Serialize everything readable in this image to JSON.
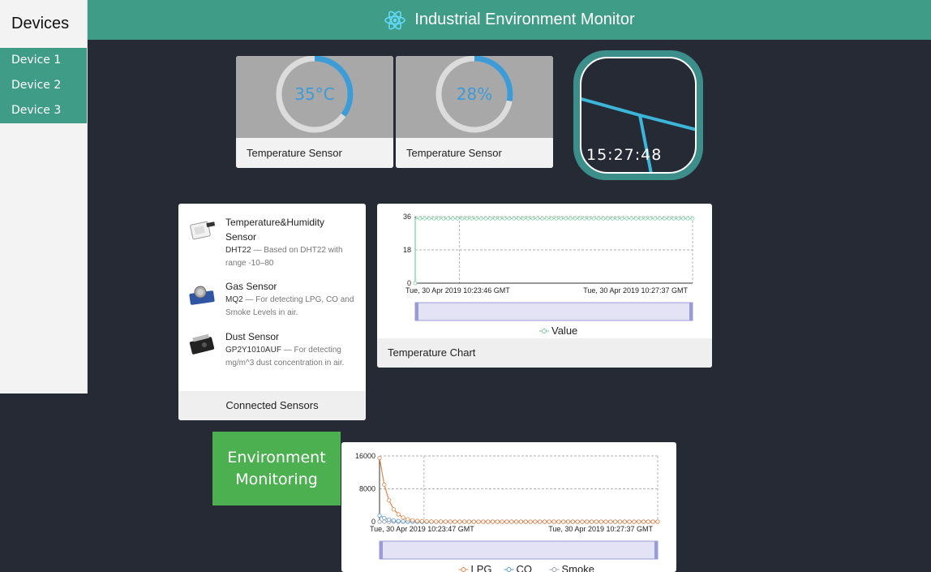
{
  "sidebar": {
    "title": "Devices",
    "items": [
      {
        "label": "Device 1"
      },
      {
        "label": "Device 2"
      },
      {
        "label": "Device 3"
      }
    ]
  },
  "header": {
    "title": "Industrial Environment Monitor",
    "icon": "react-atom-icon"
  },
  "gauges": [
    {
      "value_text": "35°C",
      "fill": 0.35,
      "label": "Temperature Sensor"
    },
    {
      "value_text": "28%",
      "fill": 0.28,
      "label": "Temperature Sensor"
    }
  ],
  "clock": {
    "time": "15:27:48"
  },
  "sensors_card": {
    "footer": "Connected Sensors",
    "items": [
      {
        "name": "Temperature&Humidity Sensor",
        "model": "DHT22",
        "desc": " — Based on DHT22 with range -10–80",
        "icon": "dht22-sensor-image"
      },
      {
        "name": "Gas Sensor",
        "model": "MQ2",
        "desc": " — For detecting LPG, CO and Smoke Levels in air.",
        "icon": "mq2-gas-sensor-image"
      },
      {
        "name": "Dust Sensor",
        "model": "GP2Y1010AUF",
        "desc": " — For detecting mg/m^3 dust concentration in air.",
        "icon": "dust-sensor-image"
      }
    ]
  },
  "temperature_card": {
    "footer": "Temperature Chart"
  },
  "environment_label": {
    "line1": "Environment",
    "line2": "Monitoring"
  },
  "colors": {
    "accent": "#3f9d87",
    "background": "#262a35",
    "gauge_arc": "#3d9bd6",
    "green_box": "#4caf50"
  },
  "chart_data": [
    {
      "type": "line",
      "title": "",
      "ylim": [
        0,
        36
      ],
      "yticks": [
        0,
        18,
        36
      ],
      "xtick_labels": [
        "Tue, 30 Apr 2019 10:23:46 GMT",
        "Tue, 30 Apr 2019 10:27:37 GMT"
      ],
      "grid": true,
      "legend_position": "bottom",
      "series": [
        {
          "name": "Value",
          "color": "#7ccfa3",
          "points": 60,
          "initial": 0,
          "steady": 35
        }
      ]
    },
    {
      "type": "line",
      "title": "",
      "ylim": [
        0,
        16000
      ],
      "yticks": [
        0,
        8000,
        16000
      ],
      "xtick_labels": [
        "Tue, 30 Apr 2019 10:23:47 GMT",
        "Tue, 30 Apr 2019 10:27:37 GMT"
      ],
      "grid": true,
      "legend_position": "bottom",
      "series": [
        {
          "name": "LPG",
          "color": "#e0864a",
          "values": [
            15500,
            9000,
            5200,
            3000,
            1800,
            1000,
            600,
            350,
            200,
            120,
            80,
            50,
            30,
            20,
            10
          ]
        },
        {
          "name": "CO",
          "color": "#5b9bd5",
          "values": [
            1500,
            900,
            500,
            300,
            150,
            80,
            40,
            20,
            10,
            5
          ]
        },
        {
          "name": "Smoke",
          "color": "#9aa0b0",
          "values": [
            0
          ]
        }
      ]
    }
  ]
}
